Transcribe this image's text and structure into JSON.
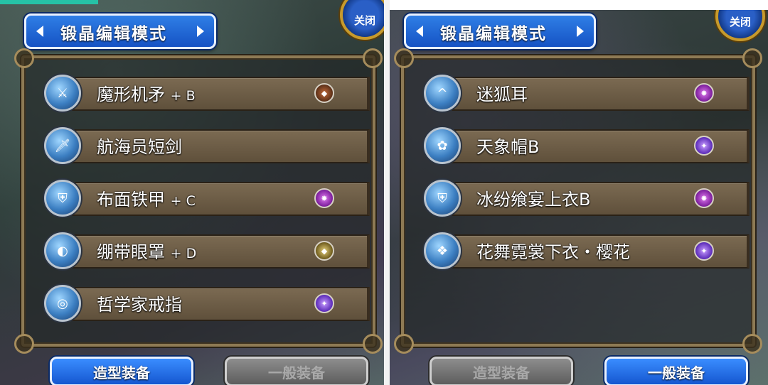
{
  "left_panel": {
    "mode_title": "锻晶编辑模式",
    "close_label": "关闭",
    "items": [
      {
        "name": "魔形机矛",
        "suffix": "+ B",
        "icon": "spear-icon",
        "badge": "brown"
      },
      {
        "name": "航海员短剑",
        "suffix": "",
        "icon": "sword-icon",
        "badge": ""
      },
      {
        "name": "布面铁甲",
        "suffix": "+ C",
        "icon": "armor-icon",
        "badge": "purple"
      },
      {
        "name": "绷带眼罩",
        "suffix": "+ D",
        "icon": "eyepatch-icon",
        "badge": "gold"
      },
      {
        "name": "哲学家戒指",
        "suffix": "",
        "icon": "ring-icon",
        "badge": "violet"
      }
    ],
    "buttons": {
      "styled_equip": "造型装备",
      "normal_equip": "一般装备"
    }
  },
  "right_panel": {
    "mode_title": "锻晶编辑模式",
    "close_label": "关闭",
    "items": [
      {
        "name": "迷狐耳",
        "suffix": "",
        "icon": "fox-ears-icon",
        "badge": "purple"
      },
      {
        "name": "天象帽B",
        "suffix": "",
        "icon": "hat-icon",
        "badge": "violet"
      },
      {
        "name": "冰纷飨宴上衣B",
        "suffix": "",
        "icon": "top-icon",
        "badge": "purple"
      },
      {
        "name": "花舞霓裳下衣・樱花",
        "suffix": "",
        "icon": "skirt-icon",
        "badge": "violet"
      }
    ],
    "buttons": {
      "styled_equip": "造型装备",
      "normal_equip": "一般装备"
    }
  },
  "colors": {
    "accent_blue": "#1f6ae0",
    "bar_brown": "#6e5d46",
    "frame_gold": "#8e7a54"
  }
}
